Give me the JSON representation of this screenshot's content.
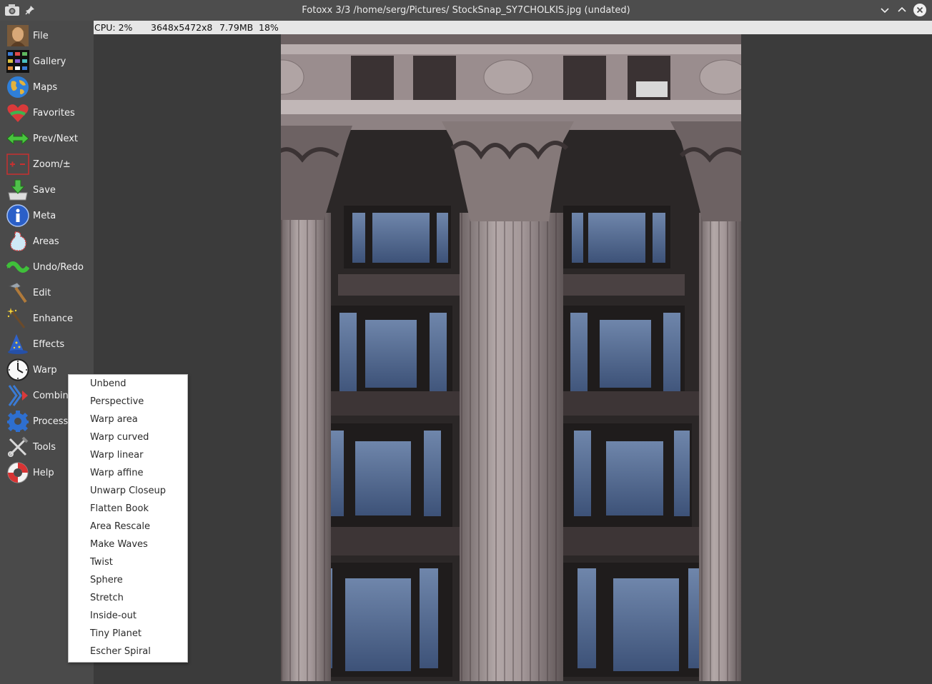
{
  "window": {
    "title": "Fotoxx 3/3 /home/serg/Pictures/ StockSnap_SY7CHOLKIS.jpg (undated)"
  },
  "status": {
    "cpu": "CPU: 2%",
    "dimensions": "3648x5472x8",
    "size": "7.79MB",
    "zoom": "18%"
  },
  "sidebar": {
    "items": [
      {
        "label": "File",
        "icon": "file-icon"
      },
      {
        "label": "Gallery",
        "icon": "gallery-icon"
      },
      {
        "label": "Maps",
        "icon": "globe-icon"
      },
      {
        "label": "Favorites",
        "icon": "heart-icon"
      },
      {
        "label": "Prev/Next",
        "icon": "arrows-icon"
      },
      {
        "label": "Zoom/±",
        "icon": "zoom-icon"
      },
      {
        "label": "Save",
        "icon": "save-icon"
      },
      {
        "label": "Meta",
        "icon": "info-icon"
      },
      {
        "label": "Areas",
        "icon": "areas-icon"
      },
      {
        "label": "Undo/Redo",
        "icon": "undo-redo-icon"
      },
      {
        "label": "Edit",
        "icon": "hammer-icon"
      },
      {
        "label": "Enhance",
        "icon": "wand-icon"
      },
      {
        "label": "Effects",
        "icon": "wizard-hat-icon"
      },
      {
        "label": "Warp",
        "icon": "clock-icon"
      },
      {
        "label": "Combine",
        "icon": "combine-icon"
      },
      {
        "label": "Process",
        "icon": "gear-icon"
      },
      {
        "label": "Tools",
        "icon": "tools-icon"
      },
      {
        "label": "Help",
        "icon": "lifebuoy-icon"
      }
    ]
  },
  "warp_menu": {
    "items": [
      "Unbend",
      "Perspective",
      "Warp area",
      "Warp curved",
      "Warp linear",
      "Warp affine",
      "Unwarp Closeup",
      "Flatten Book",
      "Area Rescale",
      "Make Waves",
      "Twist",
      "Sphere",
      "Stretch",
      "Inside-out",
      "Tiny Planet",
      "Escher Spiral"
    ]
  },
  "colors": {
    "titlebar": "#4d4d4d",
    "sidebar": "#4a4a4a",
    "canvas": "#3b3b3b",
    "status_bar": "#e6e6e6",
    "menu_bg": "#ffffff"
  }
}
